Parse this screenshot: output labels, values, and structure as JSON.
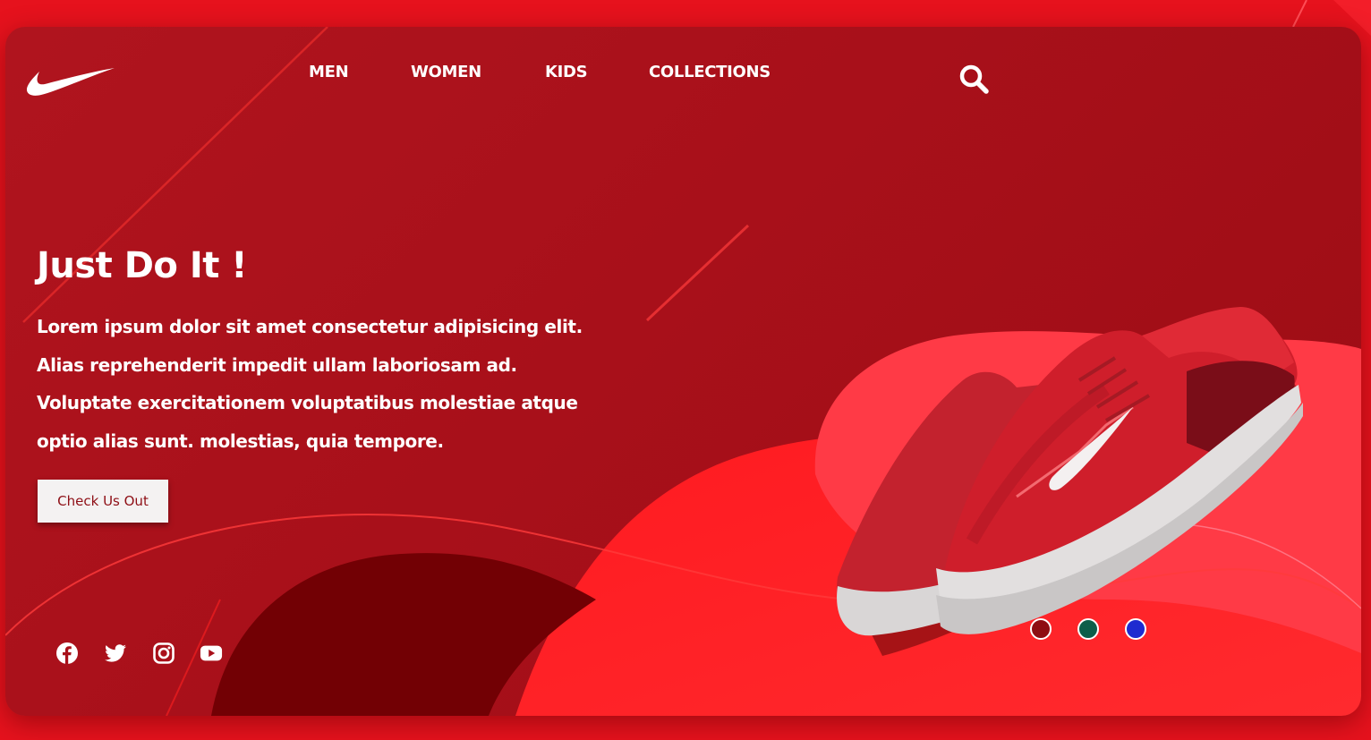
{
  "brand": {
    "logo_icon": "nike-swoosh-icon"
  },
  "nav": {
    "items": [
      {
        "label": "MEN"
      },
      {
        "label": "WOMEN"
      },
      {
        "label": "KIDS"
      },
      {
        "label": "COLLECTIONS"
      }
    ],
    "search_icon": "search-icon"
  },
  "hero": {
    "title": "Just Do It !",
    "description": "Lorem ipsum dolor sit amet consectetur adipisicing elit. Alias reprehenderit impedit ullam laboriosam ad. Voluptate exercitationem voluptatibus molestiae atque optio alias sunt. molestias, quia tempore.",
    "cta_label": "Check Us Out"
  },
  "social": [
    {
      "icon": "facebook-icon"
    },
    {
      "icon": "twitter-icon"
    },
    {
      "icon": "instagram-icon"
    },
    {
      "icon": "youtube-icon"
    }
  ],
  "color_options": [
    {
      "color": "#8e0d12"
    },
    {
      "color": "#0d5e4a"
    },
    {
      "color": "#1e2bd0"
    }
  ],
  "colors": {
    "accent_red": "#e6121d",
    "card_red": "#a8101a",
    "cta_text": "#8e0f16"
  }
}
